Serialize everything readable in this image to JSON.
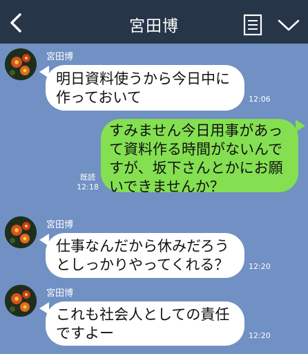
{
  "header": {
    "title": "宮田博",
    "icons": [
      "back-chevron-icon",
      "menu-list-icon",
      "chevron-down-icon"
    ]
  },
  "messages": [
    {
      "sender": "宮田博",
      "text": "明日資料使うから今日中に\n作っておいて",
      "time": "12:06"
    },
    {
      "sender": "me",
      "text": "すみません今日用事があっ\nて資料作る時間がないんで\nすが、坂下さんとかにお願\nいできませんか？",
      "read_label": "既読",
      "time": "12:18"
    },
    {
      "sender": "宮田博",
      "text": "仕事なんだから休みだろう\nとしっかりやってくれる？",
      "time": "12:20"
    },
    {
      "sender": "宮田博",
      "text": "これも社会人としての責任\nですよー",
      "time": "12:20"
    }
  ],
  "colors": {
    "background": "#7190c3",
    "header": "#263548",
    "incoming_bubble": "#ffffff",
    "outgoing_bubble": "#84e051"
  }
}
